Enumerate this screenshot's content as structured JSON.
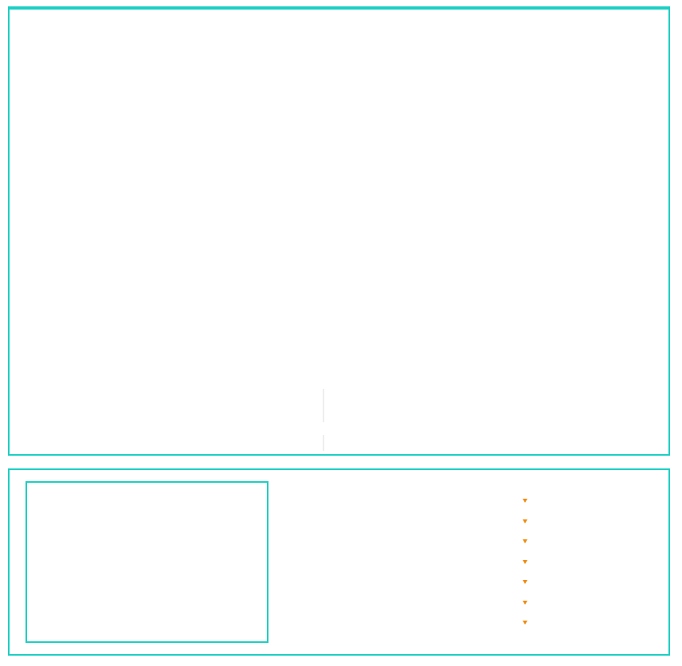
{
  "colors": {
    "accent": "#1ccfc4",
    "bullet": "#f08a0a",
    "background": "#ffffff"
  },
  "top_panel": {
    "content": ""
  },
  "bottom_panel": {
    "preview": {
      "content": ""
    },
    "list": {
      "items": [
        {
          "label": "",
          "icon": "triangle-down-icon"
        },
        {
          "label": "",
          "icon": "triangle-down-icon"
        },
        {
          "label": "",
          "icon": "triangle-down-icon"
        },
        {
          "label": "",
          "icon": "triangle-down-icon"
        },
        {
          "label": "",
          "icon": "triangle-down-icon"
        },
        {
          "label": "",
          "icon": "triangle-down-icon"
        },
        {
          "label": "",
          "icon": "triangle-down-icon"
        }
      ]
    }
  }
}
